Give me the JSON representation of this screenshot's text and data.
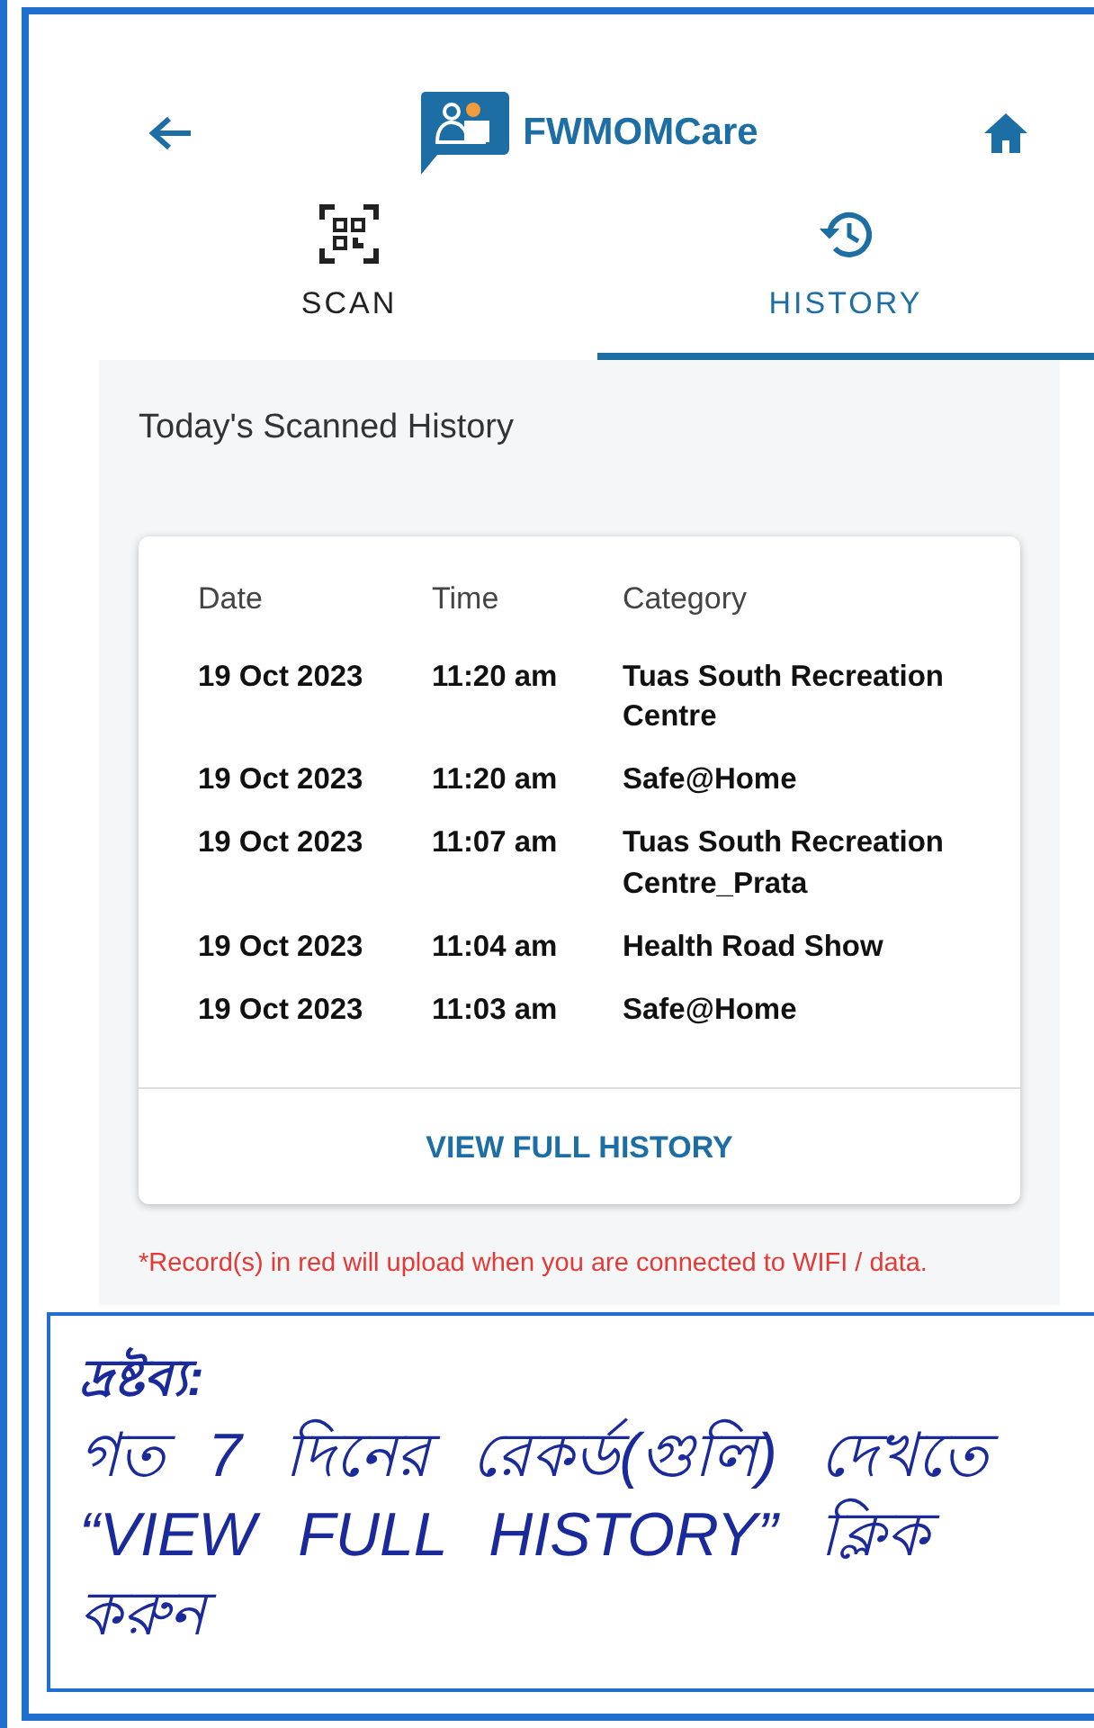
{
  "header": {
    "title": "FWMOMCare"
  },
  "tabs": [
    {
      "label": "SCAN",
      "kind": "scan",
      "selected": false
    },
    {
      "label": "HISTORY",
      "kind": "history",
      "selected": true
    }
  ],
  "history": {
    "heading": "Today's Scanned History",
    "columns": [
      "Date",
      "Time",
      "Category"
    ],
    "rows": [
      {
        "date": "19 Oct 2023",
        "time": "11:20 am",
        "category": "Tuas South Recreation Centre"
      },
      {
        "date": "19 Oct 2023",
        "time": "11:20 am",
        "category": "Safe@Home"
      },
      {
        "date": "19 Oct 2023",
        "time": "11:07 am",
        "category": "Tuas South Recreation Centre_Prata"
      },
      {
        "date": "19 Oct 2023",
        "time": "11:04 am",
        "category": "Health Road Show"
      },
      {
        "date": "19 Oct 2023",
        "time": "11:03 am",
        "category": "Safe@Home"
      }
    ],
    "footer_button": "VIEW FULL HISTORY",
    "notice": "*Record(s) in red will upload when you are connected to WIFI / data."
  },
  "note": {
    "title": "দ্রষ্টব্য:",
    "text": "গত 7 দিনের রেকর্ড(গুলি) দেখতে “VIEW FULL HISTORY” ক্লিক করুন"
  }
}
